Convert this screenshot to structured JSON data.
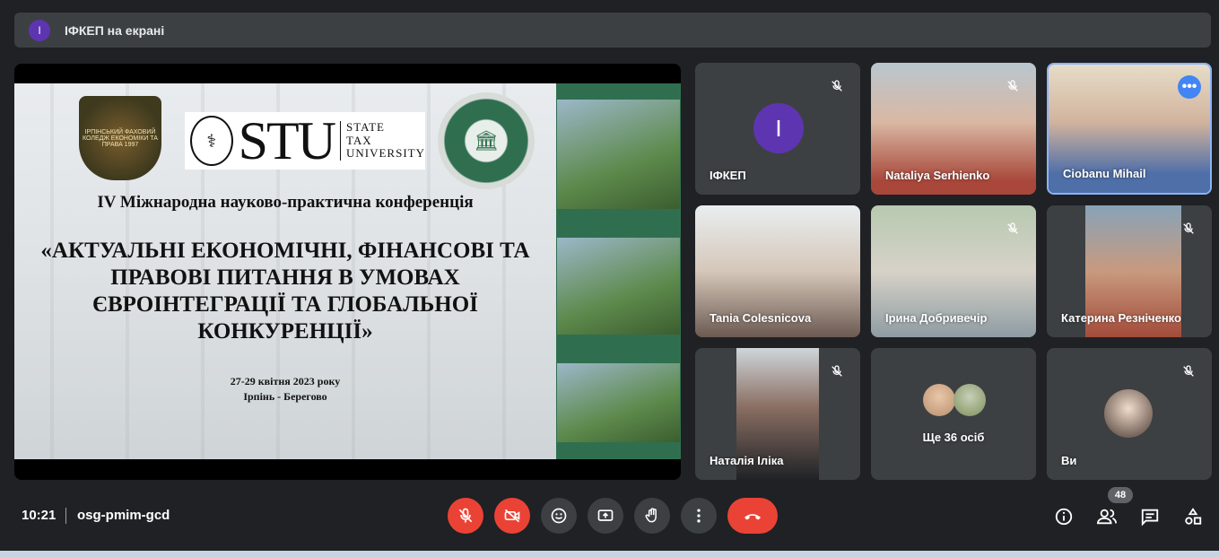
{
  "topbar": {
    "avatar_letter": "I",
    "presenting_label": "ІФКЕП на екрані"
  },
  "slide": {
    "crest_text": "ІРПІНСЬКИЙ ФАХОВИЙ КОЛЕДЖ ЕКОНОМІКИ ТА ПРАВА 1997",
    "stu_big": "STU",
    "stu_small": [
      "STATE",
      "TAX",
      "UNIVERSITY"
    ],
    "conference": "IV Міжнародна науково-практична конференція",
    "title_lines": [
      "«АКТУАЛЬНІ ЕКОНОМІЧНІ, ФІНАНСОВІ ТА",
      "ПРАВОВІ ПИТАННЯ В УМОВАХ",
      "ЄВРОІНТЕГРАЦІЇ ТА ГЛОБАЛЬНОЇ",
      "КОНКУРЕНЦІЇ»"
    ],
    "dates": "27-29 квітня 2023 року",
    "place": "Ірпінь - Берегово"
  },
  "participants": [
    {
      "name": "ІФКЕП",
      "avatar_letter": "I",
      "muted": true,
      "color": "#5e35b1"
    },
    {
      "name": "Nataliya Serhienko",
      "muted": true
    },
    {
      "name": "Ciobanu Mihail",
      "muted": false,
      "more": "•••"
    },
    {
      "name": "Tania Colesnicova",
      "muted": false
    },
    {
      "name": "Ірина Добривечір",
      "muted": true
    },
    {
      "name": "Катерина Резніченко",
      "muted": true
    },
    {
      "name": "Наталія Іліка",
      "muted": true
    },
    {
      "name": "Ще 36 осіб",
      "muted": false
    },
    {
      "name": "Ви",
      "muted": true
    }
  ],
  "bottombar": {
    "time": "10:21",
    "meeting_code": "osg-pmim-gcd",
    "people_count": "48"
  },
  "colors": {
    "background": "#202124",
    "tile": "#3c4043",
    "danger": "#ea4335",
    "accent": "#5e35b1"
  }
}
